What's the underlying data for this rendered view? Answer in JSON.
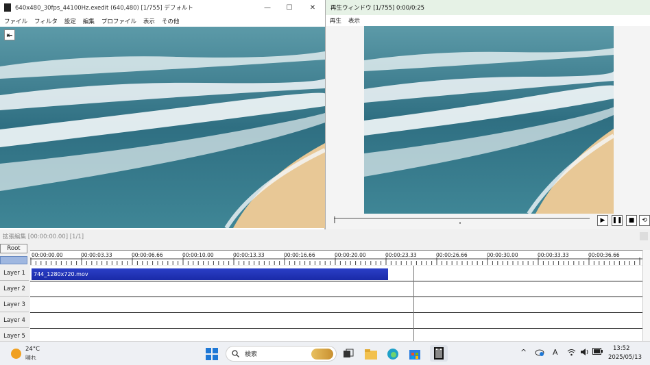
{
  "main_window": {
    "title": "640x480_30fps_44100Hz.exedit (640,480)  [1/755]  デフォルト",
    "minimize": "—",
    "maximize": "☐",
    "close": "✕",
    "menu": [
      "ファイル",
      "フィルタ",
      "設定",
      "編集",
      "プロファイル",
      "表示",
      "その他"
    ],
    "back_button": "⇤"
  },
  "playback_window": {
    "title": "再生ウィンドウ  [1/755]  0:00/0:25",
    "menu": [
      "再生",
      "表示"
    ],
    "controls": {
      "play": "▶",
      "pause": "❚❚",
      "stop": "■",
      "loop": "⟲"
    }
  },
  "timeline": {
    "status": "拡張編集 [00:00:00.00] [1/1]",
    "root_label": "Root",
    "ticks": [
      "00:00:00.00",
      "00:00:03.33",
      "00:00:06.66",
      "00:00:10.00",
      "00:00:13.33",
      "00:00:16.66",
      "00:00:20.00",
      "00:00:23.33",
      "00:00:26.66",
      "00:00:30.00",
      "00:00:33.33",
      "00:00:36.66"
    ],
    "layers": [
      "Layer 1",
      "Layer 2",
      "Layer 3",
      "Layer 4",
      "Layer 5"
    ],
    "clip_name": "744_1280x720.mov"
  },
  "taskbar": {
    "temperature": "24°C",
    "condition": "晴れ",
    "search_label": "検索",
    "time": "13:52",
    "date": "2025/05/13",
    "tray": {
      "chevron": "^",
      "ime": "A"
    }
  },
  "colors": {
    "clip": "#1a2aa8",
    "ocean": "#2f6f82",
    "sand": "#e8c896",
    "foam": "#f4f8fa"
  }
}
